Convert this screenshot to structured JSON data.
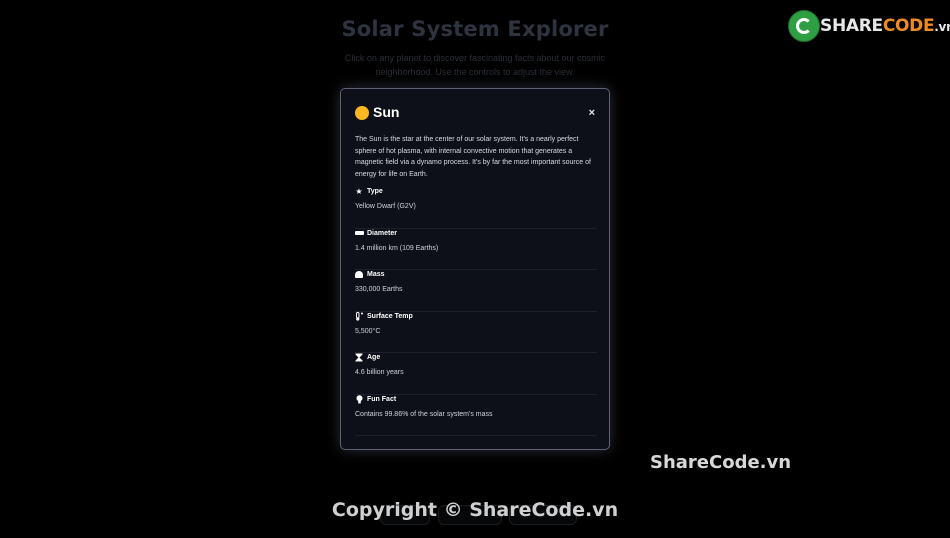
{
  "background": {
    "title": "Solar System Explorer",
    "subtitle": "Click on any planet to discover fascinating facts about our cosmic neighborhood. Use the controls to adjust the view."
  },
  "logo": {
    "part1": "SHARE",
    "part2": "CODE",
    "part3": ".vn",
    "icon": "sharecode-leaf-icon",
    "color_green": "#2ea043",
    "color_orange": "#f08a24"
  },
  "watermark": {
    "site": "ShareCode.vn",
    "copyright": "Copyright © ShareCode.vn"
  },
  "modal": {
    "title": "Sun",
    "icon": "sun-circle-icon",
    "icon_color": "#fcb620",
    "close_label": "×",
    "description": "The Sun is the star at the center of our solar system. It's a nearly perfect sphere of hot plasma, with internal convective motion that generates a magnetic field via a dynamo process. It's by far the most important source of energy for life on Earth.",
    "facts": [
      {
        "icon": "star-icon",
        "label": "Type",
        "value": "Yellow Dwarf (G2V)"
      },
      {
        "icon": "ruler-icon",
        "label": "Diameter",
        "value": "1.4 million km (109 Earths)"
      },
      {
        "icon": "weight-icon",
        "label": "Mass",
        "value": "330,000 Earths"
      },
      {
        "icon": "thermometer-icon",
        "label": "Surface Temp",
        "value": "5,500°C"
      },
      {
        "icon": "hourglass-icon",
        "label": "Age",
        "value": "4.6 billion years"
      },
      {
        "icon": "lightbulb-icon",
        "label": "Fun Fact",
        "value": "Contains 99.86% of the solar system's mass"
      }
    ]
  }
}
